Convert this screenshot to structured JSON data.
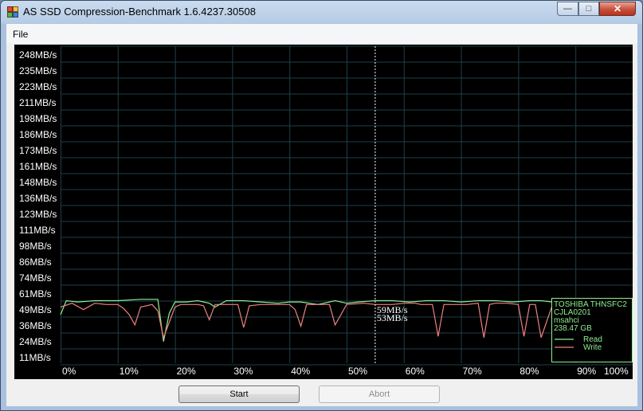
{
  "window": {
    "title": "AS SSD Compression-Benchmark 1.6.4237.30508",
    "controls": {
      "minimize": "—",
      "maximize": "□",
      "close": "✕"
    }
  },
  "menu": {
    "file": "File"
  },
  "buttons": {
    "start": "Start",
    "abort": "Abort"
  },
  "chart_data": {
    "type": "line",
    "background": "#000000",
    "grid": true,
    "y_tick_labels": [
      "248MB/s",
      "235MB/s",
      "223MB/s",
      "211MB/s",
      "198MB/s",
      "186MB/s",
      "173MB/s",
      "161MB/s",
      "148MB/s",
      "136MB/s",
      "123MB/s",
      "111MB/s",
      "98MB/s",
      "86MB/s",
      "74MB/s",
      "61MB/s",
      "49MB/s",
      "36MB/s",
      "24MB/s",
      "11MB/s"
    ],
    "x_tick_labels": [
      "0%",
      "10%",
      "20%",
      "30%",
      "40%",
      "50%",
      "60%",
      "70%",
      "80%",
      "90%",
      "100%"
    ],
    "ylim": [
      11,
      248
    ],
    "xlim": [
      0,
      100
    ],
    "cursor": {
      "x": 55,
      "read_label": "59MB/s",
      "write_label": "53MB/s"
    },
    "legend": {
      "position": "bottom-right",
      "device": [
        "TOSHIBA THNSFC2",
        "CJLA0201",
        "msahci",
        "238.47 GB"
      ],
      "read_label": "Read",
      "write_label": "Write"
    },
    "series": [
      {
        "name": "Read",
        "color": "#90ee90",
        "x": [
          0,
          1,
          3,
          6,
          10,
          14,
          17,
          18,
          19,
          20,
          22,
          24,
          26,
          27,
          29,
          32,
          35,
          38,
          40,
          42,
          45,
          48,
          50,
          52,
          55,
          58,
          61,
          64,
          67,
          70,
          73,
          76,
          79,
          82,
          84,
          86,
          88,
          91,
          94,
          97,
          100
        ],
        "values": [
          44,
          55,
          54,
          55,
          55,
          56,
          56,
          23,
          45,
          54,
          54,
          55,
          53,
          50,
          55,
          55,
          54,
          53,
          54,
          54,
          52,
          55,
          53,
          54,
          55,
          55,
          54,
          55,
          55,
          54,
          55,
          55,
          54,
          55,
          55,
          54,
          55,
          55,
          55,
          55,
          54
        ]
      },
      {
        "name": "Write",
        "color": "#f08080",
        "x": [
          0,
          2,
          4,
          6,
          8,
          10,
          11,
          12,
          13,
          14,
          16,
          17,
          18,
          20,
          21,
          22,
          24,
          25,
          26,
          27,
          29,
          31,
          32,
          33,
          35,
          36,
          38,
          40,
          41,
          42,
          43,
          45,
          46,
          47,
          48,
          50,
          53,
          55,
          58,
          60,
          62,
          63,
          65,
          66,
          67,
          69,
          71,
          73,
          74,
          75,
          76,
          78,
          80,
          81,
          82,
          83,
          84,
          86,
          88,
          89,
          90,
          92,
          93,
          94,
          96,
          97,
          98,
          100
        ],
        "values": [
          50,
          53,
          48,
          53,
          52,
          52,
          49,
          44,
          36,
          50,
          52,
          47,
          26,
          50,
          52,
          52,
          52,
          51,
          40,
          52,
          52,
          52,
          34,
          51,
          52,
          52,
          52,
          52,
          48,
          35,
          52,
          52,
          52,
          52,
          36,
          52,
          53,
          52,
          52,
          53,
          53,
          52,
          52,
          27,
          52,
          52,
          52,
          53,
          26,
          52,
          53,
          53,
          52,
          27,
          52,
          52,
          26,
          52,
          52,
          34,
          52,
          52,
          26,
          52,
          52,
          26,
          52,
          28
        ]
      }
    ]
  }
}
